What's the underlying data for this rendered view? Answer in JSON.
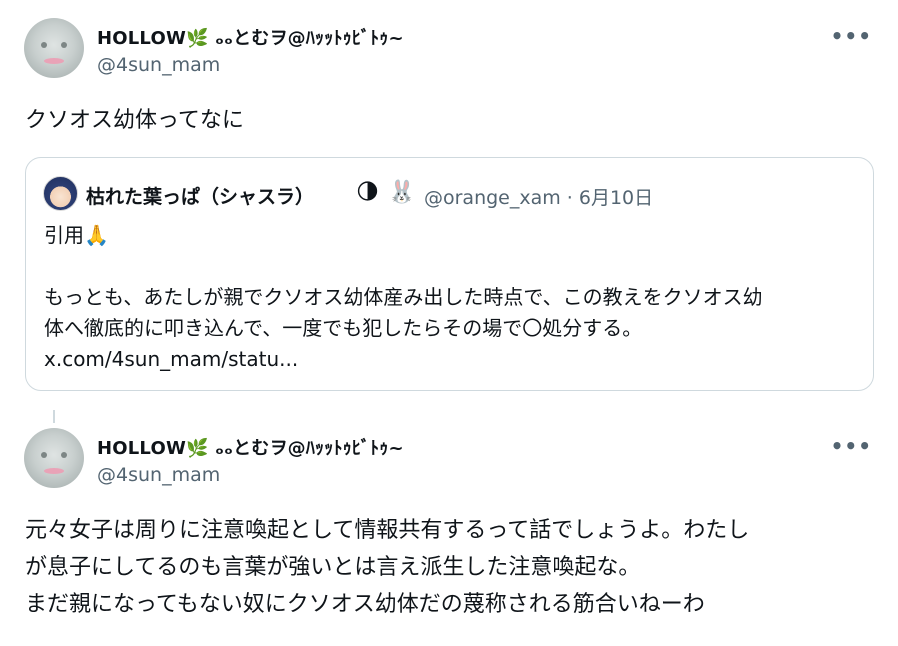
{
  "tweet1": {
    "display_name": "HOLLOW🌿 ₒₒとむヲ@ﾊｯｯﾄｩﾋﾞﾄｩ~",
    "handle": "@4sun_mam",
    "more_label": "•••",
    "text": "クソオス幼体ってなに",
    "quote": {
      "display_name": "枯れた葉っぱ（シャスラ）",
      "emoji1": "🌗",
      "emoji2": "🐰",
      "handle_date": "@orange_xam · 6月10日",
      "line1": "引用🙏",
      "line2": "もっとも、あたしが親でクソオス幼体産み出した時点で、この教えをクソオス幼",
      "line3": "体へ徹底的に叩き込んで、一度でも犯したらその場で〇処分する。",
      "link": "x.com/4sun_mam/statu..."
    }
  },
  "tweet2": {
    "display_name": "HOLLOW🌿 ₒₒとむヲ@ﾊｯｯﾄｩﾋﾞﾄｩ~",
    "handle": "@4sun_mam",
    "more_label": "•••",
    "line1": "元々女子は周りに注意喚起として情報共有するって話でしょうよ。わたし",
    "line2": "が息子にしてるのも言葉が強いとは言え派生した注意喚起な。",
    "line3": "まだ親になってもない奴にクソオス幼体だの蔑称される筋合いねーわ"
  },
  "colors": {
    "text": "#0f1419",
    "secondary": "#536471",
    "border": "#cfd9de"
  }
}
